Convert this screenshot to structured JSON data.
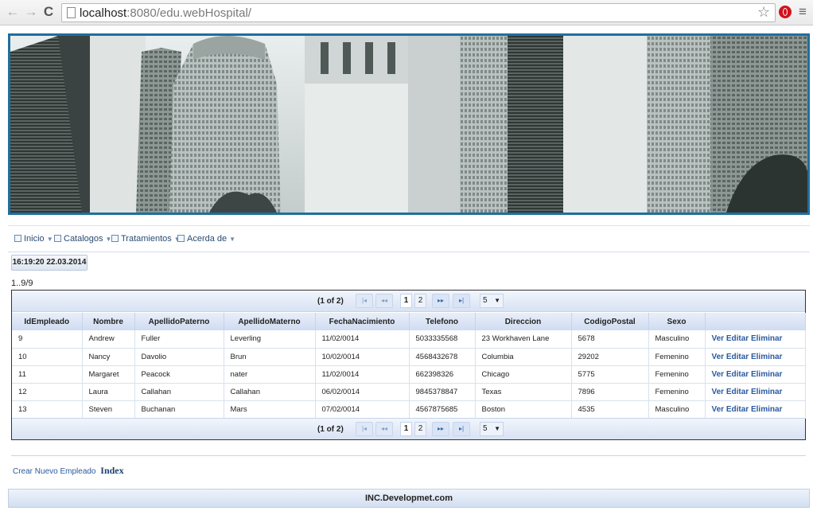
{
  "browser": {
    "back_glyph": "←",
    "forward_glyph": "→",
    "reload_glyph": "C",
    "url_host": "localhost",
    "url_rest": ":8080/edu.webHospital/",
    "star_glyph": "☆",
    "menu_glyph": "≡"
  },
  "menu": [
    {
      "label": "Inicio",
      "icon": "document-icon"
    },
    {
      "label": "Catalogos",
      "icon": "flag-icon"
    },
    {
      "label": "Tratamientos",
      "icon": "building-icon"
    },
    {
      "label": "Acerda de",
      "icon": "gear-icon"
    }
  ],
  "clock": "16:19:20 22.03.2014",
  "record_count": "1..9/9",
  "pager": {
    "text": "(1 of 2)",
    "pages": [
      "1",
      "2"
    ],
    "current_page": 1,
    "page_size": "5",
    "first": "|◂",
    "prev": "◂◂",
    "next": "▸▸",
    "last": "▸|",
    "dropdown": "▼"
  },
  "table": {
    "columns": [
      "IdEmpleado",
      "Nombre",
      "ApellidoPaterno",
      "ApellidoMaterno",
      "FechaNacimiento",
      "Telefono",
      "Direccion",
      "CodigoPostal",
      "Sexo",
      ""
    ],
    "rows": [
      [
        "9",
        "Andrew",
        "Fuller",
        "Leverling",
        "11/02/0014",
        "5033335568",
        "23 Workhaven Lane",
        "5678",
        "Masculino"
      ],
      [
        "10",
        "Nancy",
        "Davolio",
        "Brun",
        "10/02/0014",
        "4568432678",
        "Columbia",
        "29202",
        "Femenino"
      ],
      [
        "11",
        "Margaret",
        "Peacock",
        "nater",
        "11/02/0014",
        "662398326",
        "Chicago",
        "5775",
        "Femenino"
      ],
      [
        "12",
        "Laura",
        "Callahan",
        "Callahan",
        "06/02/0014",
        "9845378847",
        "Texas",
        "7896",
        "Femenino"
      ],
      [
        "13",
        "Steven",
        "Buchanan",
        "Mars",
        "07/02/0014",
        "4567875685",
        "Boston",
        "4535",
        "Masculino"
      ]
    ],
    "action_labels": [
      "Ver",
      "Editar",
      "Eliminar"
    ]
  },
  "links": {
    "create": "Crear Nuevo Empleado",
    "index": "Index"
  },
  "footer": "INC.Developmet.com",
  "colors": {
    "banner_border": "#1f6f9d",
    "link": "#2a5aa0",
    "header_bg": "#d7e2f4"
  }
}
